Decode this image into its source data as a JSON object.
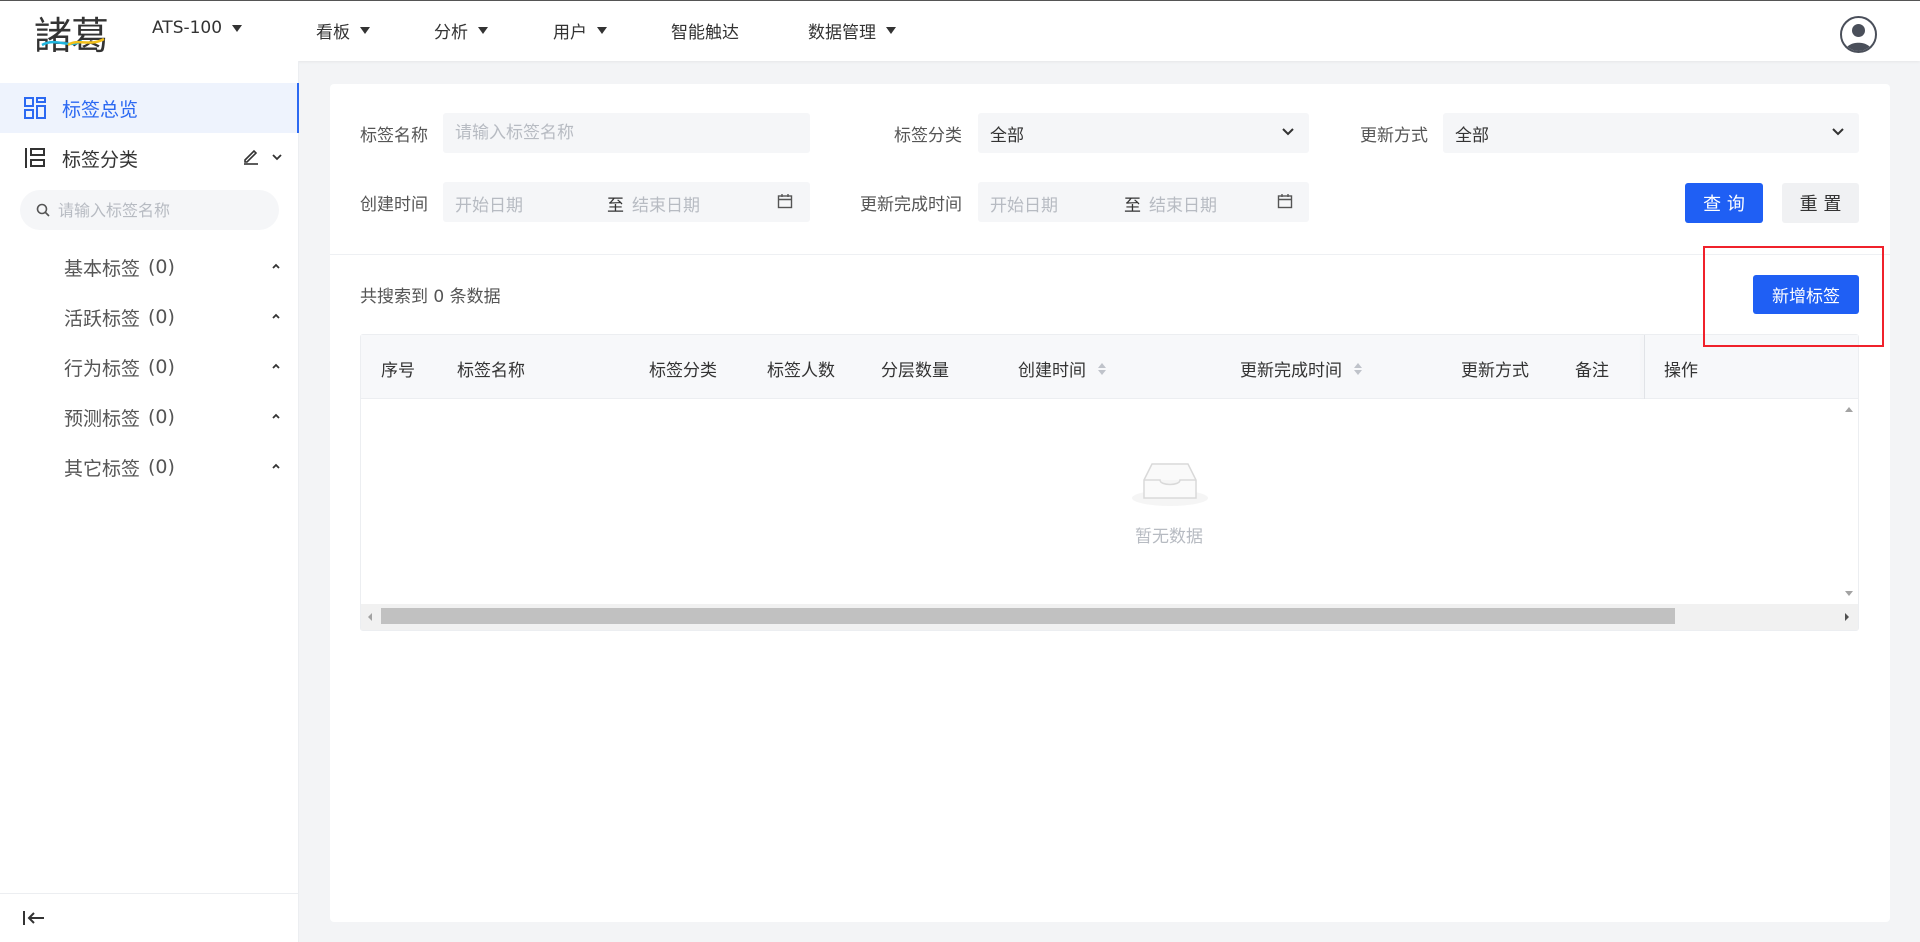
{
  "header": {
    "logo_text": "諸葛",
    "project": "ATS-100",
    "nav": [
      "看板",
      "分析",
      "用户",
      "智能触达",
      "数据管理"
    ]
  },
  "sidebar": {
    "overview_label": "标签总览",
    "category_label": "标签分类",
    "search_placeholder": "请输入标签名称",
    "tree": [
      {
        "label": "基本标签",
        "count": "(0)"
      },
      {
        "label": "活跃标签",
        "count": "(0)"
      },
      {
        "label": "行为标签",
        "count": "(0)"
      },
      {
        "label": "预测标签",
        "count": "(0)"
      },
      {
        "label": "其它标签",
        "count": "(0)"
      }
    ]
  },
  "filters": {
    "name_label": "标签名称",
    "name_placeholder": "请输入标签名称",
    "category_label": "标签分类",
    "category_value": "全部",
    "update_mode_label": "更新方式",
    "update_mode_value": "全部",
    "created_label": "创建时间",
    "updated_label": "更新完成时间",
    "start_placeholder": "开始日期",
    "to": "至",
    "end_placeholder": "结束日期",
    "query_button": "查 询",
    "reset_button": "重 置"
  },
  "results": {
    "count_text": "共搜索到 0 条数据",
    "add_button": "新增标签"
  },
  "table": {
    "columns": [
      "序号",
      "标签名称",
      "标签分类",
      "标签人数",
      "分层数量",
      "创建时间",
      "更新完成时间",
      "更新方式",
      "备注",
      "操作"
    ],
    "empty_text": "暂无数据"
  },
  "colors": {
    "primary": "#1f5ff4",
    "highlight_border": "#f0212b",
    "sidebar_active_bg": "#eef3fd"
  }
}
